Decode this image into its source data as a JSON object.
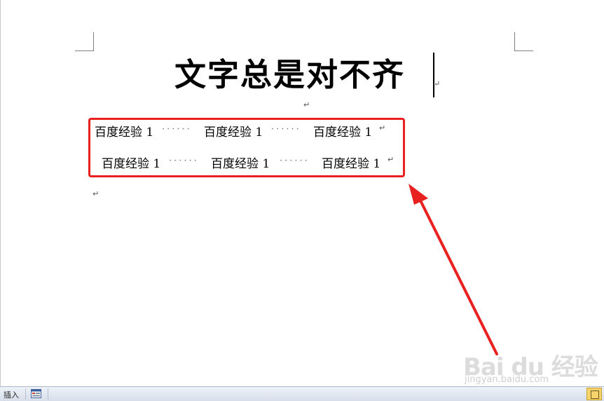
{
  "document": {
    "title": "文字总是对不齐",
    "mark": "↵",
    "rows": [
      {
        "cells": [
          "百度经验 1",
          "百度经验 1",
          "百度经验 1"
        ],
        "leader": "······"
      },
      {
        "cells": [
          "百度经验 1",
          "百度经验 1",
          "百度经验 1"
        ],
        "leader": "······"
      }
    ]
  },
  "annotation": {
    "box_color": "#e8201f",
    "arrow_color": "#e8201f"
  },
  "watermark": {
    "logo": "Bai du 经验",
    "url": "jingyan.baidu.com"
  },
  "statusbar": {
    "insert_label": "插入",
    "macro_icon": "macro-record-icon",
    "view_icon": "print-layout-view-icon"
  }
}
